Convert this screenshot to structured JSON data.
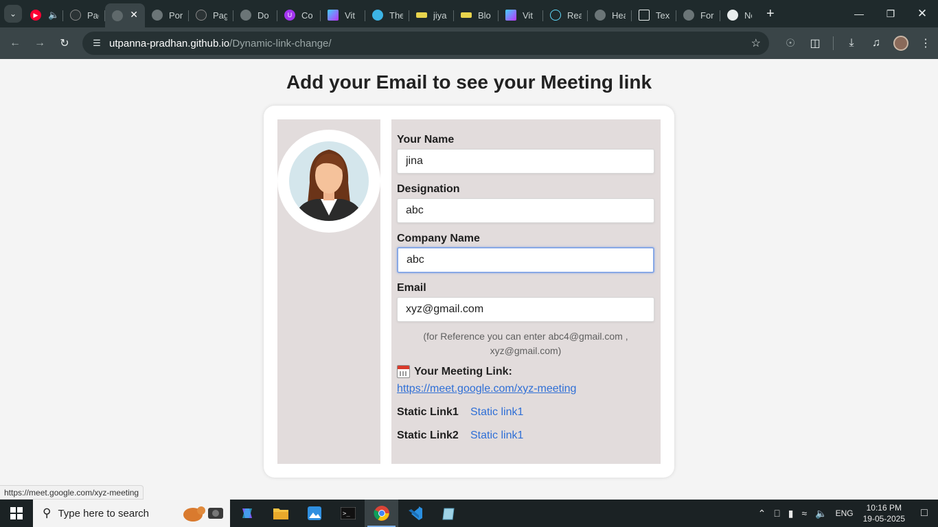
{
  "browser": {
    "tabs": [
      {
        "label": "",
        "icon": "youtube-music-icon",
        "color": "#ff0033"
      },
      {
        "label": "",
        "icon": "speaker-icon",
        "color": ""
      },
      {
        "label": "Pag",
        "icon": "github-icon",
        "color": "#2b3335"
      },
      {
        "label": "",
        "icon": "globe-icon",
        "color": "#6b7577"
      },
      {
        "label": "Por",
        "icon": "globe-icon",
        "color": "#6b7577"
      },
      {
        "label": "Pag",
        "icon": "github-icon",
        "color": "#2b3335"
      },
      {
        "label": "Do",
        "icon": "globe-icon",
        "color": "#6b7577"
      },
      {
        "label": "Co",
        "icon": "udemy-icon",
        "color": "#a435f0"
      },
      {
        "label": "Vit",
        "icon": "vite-icon",
        "color": "#9d6cf7"
      },
      {
        "label": "The",
        "icon": "cloud-icon",
        "color": "#3cb4e5"
      },
      {
        "label": "jiya",
        "icon": "label-icon",
        "color": "#e8d44d"
      },
      {
        "label": "Blo",
        "icon": "label-icon",
        "color": "#e8d44d"
      },
      {
        "label": "Vit",
        "icon": "vite-icon",
        "color": "#9d6cf7"
      },
      {
        "label": "Rea",
        "icon": "react-icon",
        "color": "#61dafb"
      },
      {
        "label": "Hea",
        "icon": "globe-icon",
        "color": "#6b7577"
      },
      {
        "label": "Tex",
        "icon": "document-icon",
        "color": "#e8eded"
      },
      {
        "label": "For",
        "icon": "globe-icon",
        "color": "#6b7577"
      },
      {
        "label": "Nev",
        "icon": "chrome-icon",
        "color": "#e8eded"
      }
    ],
    "url_domain": "utpanna-pradhan.github.io",
    "url_path": "/Dynamic-link-change/",
    "status_url": "https://meet.google.com/xyz-meeting"
  },
  "page": {
    "title": "Add your Email to see your Meeting link"
  },
  "form": {
    "name_label": "Your Name",
    "name_value": "jina",
    "designation_label": "Designation",
    "designation_value": "abc",
    "company_label": "Company Name",
    "company_value": "abc",
    "email_label": "Email",
    "email_value": "xyz@gmail.com",
    "reference_note": "(for Reference you can enter abc4@gmail.com , xyz@gmail.com)"
  },
  "meeting": {
    "label": "Your Meeting Link:",
    "link": "https://meet.google.com/xyz-meeting"
  },
  "static_links": [
    {
      "label": "Static Link1",
      "value": "Static link1"
    },
    {
      "label": "Static Link2",
      "value": "Static link1"
    }
  ],
  "taskbar": {
    "search_placeholder": "Type here to search",
    "language": "ENG",
    "time": "10:16 PM",
    "date": "19-05-2025",
    "accent_color": "#7fb0e8"
  }
}
